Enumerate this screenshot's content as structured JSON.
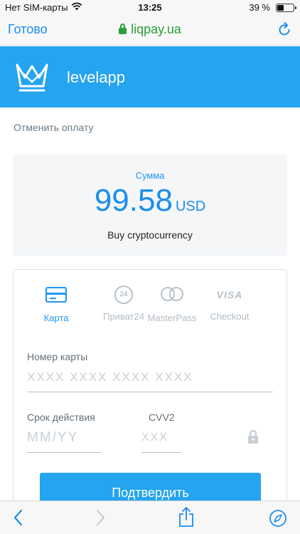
{
  "status_bar": {
    "carrier": "Нет SIM-карты",
    "time": "13:25",
    "battery_text": "39 %",
    "battery_level": 0.39
  },
  "browser": {
    "done_label": "Готово",
    "url": "liqpay.ua"
  },
  "app": {
    "name": "levelapp"
  },
  "cancel_label": "Отменить оплату",
  "amount": {
    "label": "Сумма",
    "value": "99.58",
    "currency": "USD",
    "description": "Buy cryptocurrency"
  },
  "payment_methods": [
    {
      "label": "Карта",
      "icon": "card-icon",
      "active": true
    },
    {
      "label": "Приват24",
      "icon": "privat24-icon",
      "icon_text": "24",
      "active": false
    },
    {
      "label": "MasterPass",
      "icon": "masterpass-icon",
      "active": false
    },
    {
      "label": "Checkout",
      "icon": "visa-icon",
      "icon_text": "VISA",
      "active": false
    }
  ],
  "form": {
    "card_number_label": "Номер карты",
    "card_number_placeholder": "XXXX XXXX XXXX XXXX",
    "expiry_label": "Срок действия",
    "expiry_placeholder": "MM/YY",
    "cvv_label": "CVV2",
    "cvv_placeholder": "XXX",
    "submit_label": "Подтвердить"
  },
  "colors": {
    "brand_blue": "#25a4f0",
    "link_blue": "#1a8cf0",
    "secure_green": "#2a9e3a"
  }
}
